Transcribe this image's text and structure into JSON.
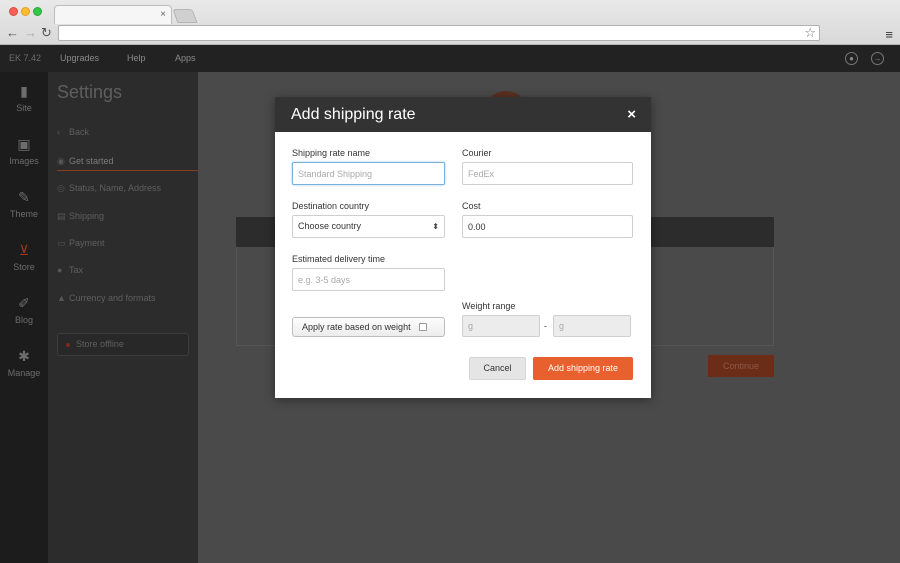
{
  "browser": {
    "tab_close": "×",
    "back": "←",
    "forward": "→",
    "reload": "↻",
    "star": "☆",
    "menu": "≡"
  },
  "topbar": {
    "brand": "EK 7.42",
    "links": [
      "Upgrades",
      "Help",
      "Apps"
    ]
  },
  "rail": {
    "items": [
      {
        "label": "Site",
        "icon": "site-icon",
        "glyph": "▮"
      },
      {
        "label": "Images",
        "icon": "images-icon",
        "glyph": "▣"
      },
      {
        "label": "Theme",
        "icon": "brush-icon",
        "glyph": "✎"
      },
      {
        "label": "Store",
        "icon": "cart-icon",
        "glyph": "⊻"
      },
      {
        "label": "Blog",
        "icon": "blog-icon",
        "glyph": "✐"
      },
      {
        "label": "Manage",
        "icon": "gear-icon",
        "glyph": "✱"
      }
    ]
  },
  "settings": {
    "title": "Settings",
    "back": "Back",
    "items": [
      {
        "label": "Get started",
        "glyph": "◉"
      },
      {
        "label": "Status, Name, Address",
        "glyph": "◎"
      },
      {
        "label": "Shipping",
        "glyph": "▤"
      },
      {
        "label": "Payment",
        "glyph": "▭"
      },
      {
        "label": "Tax",
        "glyph": "●"
      },
      {
        "label": "Currency and formats",
        "glyph": "▲"
      }
    ],
    "store_offline": "Store offline"
  },
  "background": {
    "continue": "Continue"
  },
  "modal": {
    "title": "Add shipping rate",
    "close": "×",
    "name_label": "Shipping rate name",
    "name_placeholder": "Standard Shipping",
    "courier_label": "Courier",
    "courier_placeholder": "FedEx",
    "country_label": "Destination country",
    "country_value": "Choose country",
    "cost_label": "Cost",
    "cost_value": "0.00",
    "delivery_label": "Estimated delivery time",
    "delivery_placeholder": "e.g. 3-5 days",
    "weight_label": "Weight range",
    "weight_toggle": "Apply rate based on weight",
    "weight_from_placeholder": "g",
    "weight_to_placeholder": "g",
    "weight_dash": "-",
    "cancel": "Cancel",
    "submit": "Add shipping rate"
  },
  "colors": {
    "accent": "#e8602d",
    "modal_header": "#333333"
  }
}
